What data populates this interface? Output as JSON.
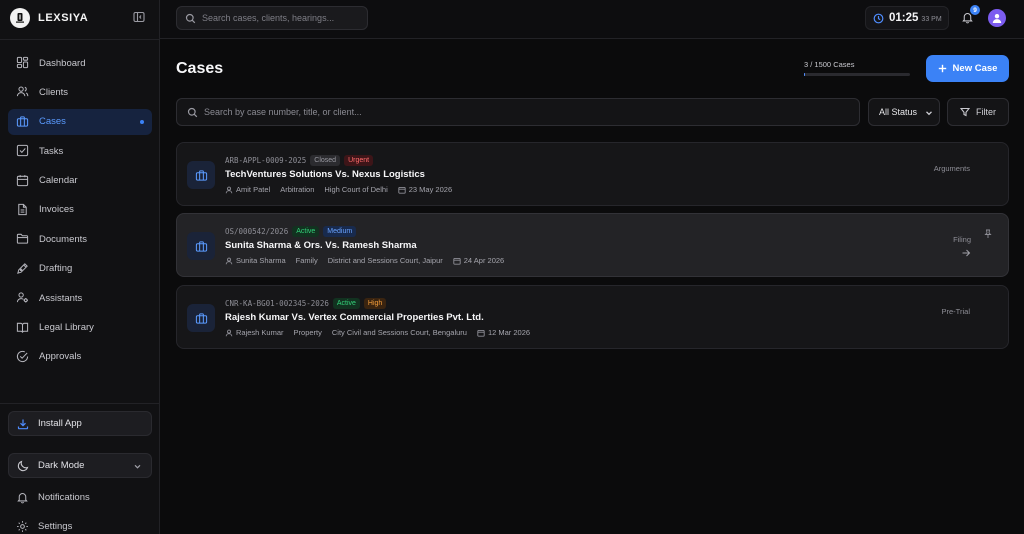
{
  "brand": {
    "name": "LEXSIYA"
  },
  "sidebar": {
    "items": [
      {
        "label": "Dashboard",
        "icon": "dashboard-icon"
      },
      {
        "label": "Clients",
        "icon": "users-icon"
      },
      {
        "label": "Cases",
        "icon": "briefcase-icon",
        "active": true
      },
      {
        "label": "Tasks",
        "icon": "checkbox-icon"
      },
      {
        "label": "Calendar",
        "icon": "calendar-icon"
      },
      {
        "label": "Invoices",
        "icon": "file-icon"
      },
      {
        "label": "Documents",
        "icon": "folder-icon"
      },
      {
        "label": "Drafting",
        "icon": "pen-icon"
      },
      {
        "label": "Assistants",
        "icon": "user-gear-icon"
      },
      {
        "label": "Legal Library",
        "icon": "book-icon"
      },
      {
        "label": "Approvals",
        "icon": "check-circle-icon"
      }
    ],
    "install_label": "Install App",
    "darkmode_label": "Dark Mode",
    "notifications_label": "Notifications",
    "settings_label": "Settings"
  },
  "topbar": {
    "search_placeholder": "Search cases, clients, hearings...",
    "clock_time": "01:25",
    "clock_ampm": "33 PM",
    "notification_count": "9"
  },
  "main": {
    "title": "Cases",
    "count_text": "3 / 1500 Cases",
    "count_fraction": 0.002,
    "new_case_label": "New Case",
    "search_placeholder": "Search by case number, title, or client...",
    "status_filter": "All Status",
    "filter_label": "Filter"
  },
  "cases": [
    {
      "number": "ARB-APPL-0009-2025",
      "status": "Closed",
      "priority": "Urgent",
      "title": "TechVentures Solutions Vs. Nexus Logistics",
      "client": "Amit Patel",
      "type": "Arbitration",
      "court": "High Court of Delhi",
      "date": "23 May 2026",
      "stage": "Arguments"
    },
    {
      "number": "OS/000542/2026",
      "status": "Active",
      "priority": "Medium",
      "title": "Sunita Sharma & Ors. Vs. Ramesh Sharma",
      "client": "Sunita Sharma",
      "type": "Family",
      "court": "District and Sessions Court, Jaipur",
      "date": "24 Apr 2026",
      "stage": "Filing"
    },
    {
      "number": "CNR-KA-BG01-002345-2026",
      "status": "Active",
      "priority": "High",
      "title": "Rajesh Kumar Vs. Vertex Commercial Properties Pvt. Ltd.",
      "client": "Rajesh Kumar",
      "type": "Property",
      "court": "City Civil and Sessions Court, Bengaluru",
      "date": "12 Mar 2026",
      "stage": "Pre-Trial"
    }
  ],
  "colors": {
    "accent": "#3b82f6",
    "closed_bg": "#2b2b2f",
    "closed_fg": "#9a9aa2",
    "urgent_bg": "#3d1518",
    "urgent_fg": "#ff6b6b",
    "active_bg": "#123220",
    "active_fg": "#34d27a",
    "medium_bg": "#182a4d",
    "medium_fg": "#6aa3ff",
    "high_bg": "#3a2410",
    "high_fg": "#f59e3b"
  }
}
